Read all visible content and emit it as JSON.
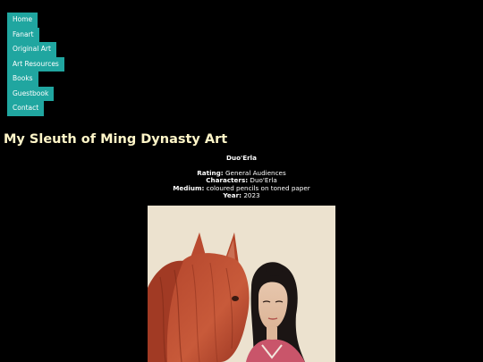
{
  "nav": {
    "items": [
      {
        "label": "Home"
      },
      {
        "label": "Fanart"
      },
      {
        "label": "Original Art"
      },
      {
        "label": "Art Resources"
      },
      {
        "label": "Books"
      },
      {
        "label": "Guestbook"
      },
      {
        "label": "Contact"
      }
    ]
  },
  "page_title": "My Sleuth of Ming Dynasty Art",
  "artwork": {
    "name": "Duo'Erla",
    "rating_label": "Rating:",
    "rating_value": "General Audiences",
    "characters_label": "Characters:",
    "characters_value": "Duo'Erla",
    "medium_label": "Medium:",
    "medium_value": "coloured pencils on toned paper",
    "year_label": "Year:",
    "year_value": "2023"
  },
  "colors": {
    "background": "#000000",
    "nav_button": "#20a6a0",
    "title": "#fff6c8",
    "paper": "#ece2cf"
  }
}
